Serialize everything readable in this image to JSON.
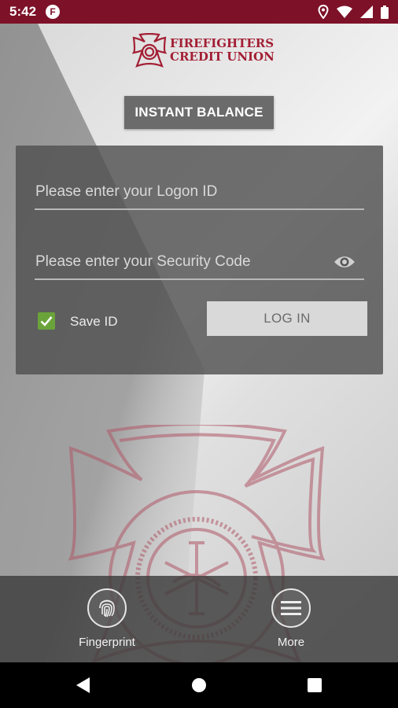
{
  "status": {
    "time": "5:42",
    "app_icon": "F"
  },
  "logo": {
    "line1": "FIREFIGHTERS",
    "line2": "CREDIT UNION"
  },
  "instant_balance_label": "INSTANT BALANCE",
  "login": {
    "logon_placeholder": "Please enter your Logon ID",
    "security_placeholder": "Please enter your Security Code",
    "save_id_label": "Save ID",
    "save_id_checked": true,
    "login_label": "LOG IN"
  },
  "bottom": {
    "fingerprint_label": "Fingerprint",
    "more_label": "More"
  },
  "colors": {
    "status_bar": "#7d1128",
    "brand_red": "#a31f34",
    "check_green": "#6aa33a"
  }
}
